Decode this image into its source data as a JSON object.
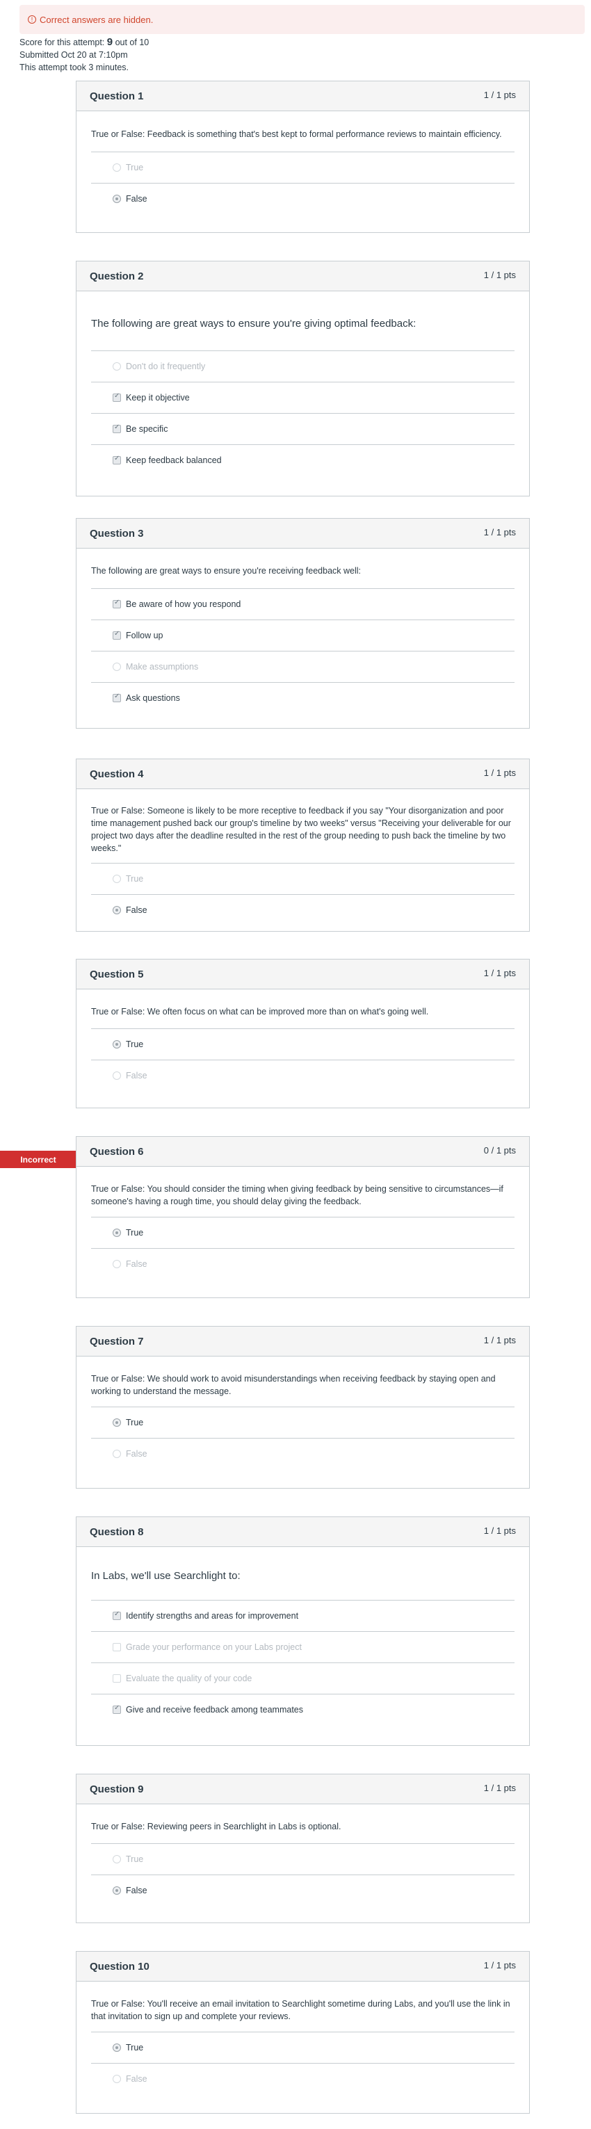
{
  "banner": {
    "icon": "info-icon",
    "text": "Correct answers are hidden."
  },
  "attempt": {
    "score_prefix": "Score for this attempt: ",
    "score": "9",
    "score_suffix": " out of 10",
    "submitted": "Submitted Oct 20 at 7:10pm",
    "duration": "This attempt took 3 minutes."
  },
  "incorrect_label": "Incorrect",
  "colors": {
    "incorrect": "#d12f2f",
    "banner_text": "#d0452c",
    "banner_bg": "#fbeeee"
  },
  "questions": [
    {
      "title": "Question 1",
      "pts": "1 / 1 pts",
      "type": "radio",
      "text": "True or False: Feedback is something that's best kept to formal performance reviews to maintain efficiency.",
      "answers": [
        {
          "label": "True",
          "selected": false
        },
        {
          "label": "False",
          "selected": true
        }
      ]
    },
    {
      "title": "Question 2",
      "pts": "1 / 1 pts",
      "type": "checkbox",
      "text": "The following are great ways to ensure you're giving optimal feedback:",
      "answers": [
        {
          "label": "Don't do it frequently",
          "selected": false
        },
        {
          "label": "Keep it objective",
          "selected": true
        },
        {
          "label": "Be specific",
          "selected": true
        },
        {
          "label": "Keep feedback balanced",
          "selected": true
        }
      ]
    },
    {
      "title": "Question 3",
      "pts": "1 / 1 pts",
      "type": "checkbox",
      "text": "The following are great ways to ensure you're receiving feedback well:",
      "answers": [
        {
          "label": "Be aware of how you respond",
          "selected": true
        },
        {
          "label": "Follow up",
          "selected": true
        },
        {
          "label": "Make assumptions",
          "selected": false
        },
        {
          "label": "Ask questions",
          "selected": true
        }
      ]
    },
    {
      "title": "Question 4",
      "pts": "1 / 1 pts",
      "type": "radio",
      "text": "True or False: Someone is likely to be more receptive to feedback if you say \"Your disorganization and poor time management pushed back our group's timeline by two weeks\" versus \"Receiving your deliverable for our project two days after the deadline resulted in the rest of the group needing to push back the timeline by two weeks.\"",
      "answers": [
        {
          "label": "True",
          "selected": false
        },
        {
          "label": "False",
          "selected": true
        }
      ]
    },
    {
      "title": "Question 5",
      "pts": "1 / 1 pts",
      "type": "radio",
      "text": "True or False: We often focus on what can be improved more than on what's going well.",
      "answers": [
        {
          "label": "True",
          "selected": true
        },
        {
          "label": "False",
          "selected": false
        }
      ]
    },
    {
      "title": "Question 6",
      "pts": "0 / 1 pts",
      "type": "radio",
      "text": "True or False: You should consider the timing when giving feedback by being sensitive to circumstances—if someone's having a rough time, you should delay giving the feedback.",
      "answers": [
        {
          "label": "True",
          "selected": true
        },
        {
          "label": "False",
          "selected": false
        }
      ]
    },
    {
      "title": "Question 7",
      "pts": "1 / 1 pts",
      "type": "radio",
      "text": "True or False: We should work to avoid misunderstandings when receiving feedback by staying open and working to understand the message.",
      "answers": [
        {
          "label": "True",
          "selected": true
        },
        {
          "label": "False",
          "selected": false
        }
      ]
    },
    {
      "title": "Question 8",
      "pts": "1 / 1 pts",
      "type": "checkbox",
      "text": "In Labs, we'll use Searchlight to:",
      "answers": [
        {
          "label": "Identify strengths and areas for improvement",
          "selected": true
        },
        {
          "label": "Grade your performance on your Labs project",
          "selected": false
        },
        {
          "label": "Evaluate the quality of your code",
          "selected": false
        },
        {
          "label": "Give and receive feedback among teammates",
          "selected": true
        }
      ]
    },
    {
      "title": "Question 9",
      "pts": "1 / 1 pts",
      "type": "radio",
      "text": "True or False: Reviewing peers in Searchlight in Labs is optional.",
      "answers": [
        {
          "label": "True",
          "selected": false
        },
        {
          "label": "False",
          "selected": true
        }
      ]
    },
    {
      "title": "Question 10",
      "pts": "1 / 1 pts",
      "type": "radio",
      "text": "True or False: You'll receive an email invitation to Searchlight sometime during Labs, and you'll use the link in that invitation to sign up and complete your reviews.",
      "answers": [
        {
          "label": "True",
          "selected": true
        },
        {
          "label": "False",
          "selected": false
        }
      ]
    }
  ]
}
